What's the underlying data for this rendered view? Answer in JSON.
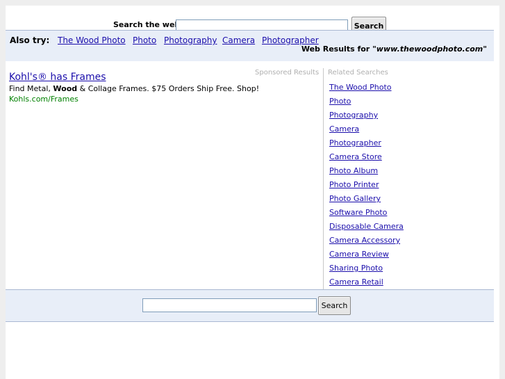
{
  "top_search": {
    "label": "Search the web:",
    "input_value": "",
    "button_label": "Search"
  },
  "also_try": {
    "label": "Also try:",
    "links": [
      "The Wood Photo",
      "Photo",
      "Photography",
      "Camera",
      "Photographer"
    ],
    "results_prefix": "Web Results for",
    "results_query": "\"www.thewoodphoto.com\""
  },
  "sponsored": {
    "label": "Sponsored Results",
    "ad": {
      "title": "Kohl's® has Frames",
      "desc_before": "Find Metal,",
      "desc_bold": "Wood",
      "desc_after": "& Collage Frames. $75 Orders Ship Free. Shop!",
      "url": "Kohls.com/Frames"
    }
  },
  "related": {
    "label": "Related Searches",
    "items": [
      "The Wood Photo",
      "Photo",
      "Photography",
      "Camera",
      "Photographer",
      "Camera Store",
      "Photo Album",
      "Photo Printer",
      "Photo Gallery",
      "Software Photo",
      "Disposable Camera",
      "Camera Accessory",
      "Camera Review",
      "Sharing Photo",
      "Camera Retail"
    ]
  },
  "bottom_search": {
    "input_value": "",
    "button_label": "Search"
  }
}
